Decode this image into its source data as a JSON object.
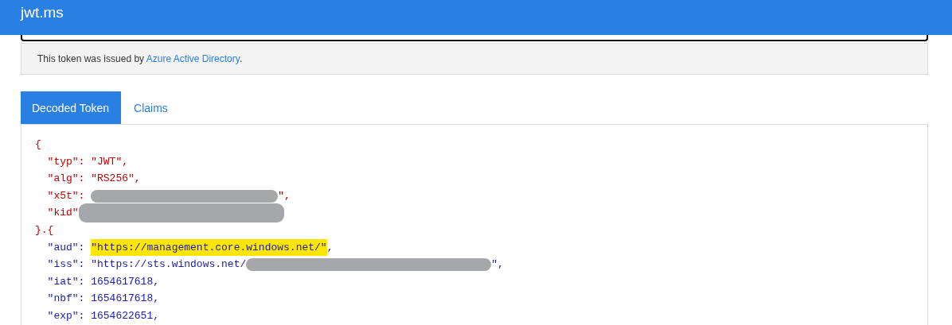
{
  "header": {
    "title": "jwt.ms"
  },
  "issuer_notice": {
    "text": "This token was issued by ",
    "link": "Azure Active Directory",
    "end": "."
  },
  "tabs": [
    {
      "label": "Decoded Token",
      "selected": true
    },
    {
      "label": "Claims",
      "selected": false
    }
  ],
  "decoded_token": {
    "lines": [
      {
        "color": "#c00000",
        "parts": [
          {
            "kind": "text",
            "text": "{"
          }
        ]
      },
      {
        "color": "#c00000",
        "parts": [
          {
            "kind": "text",
            "text": "  \"typ\": \"JWT\","
          }
        ]
      },
      {
        "color": "#c00000",
        "parts": [
          {
            "kind": "text",
            "text": "  \"alg\": \"RS256\","
          }
        ]
      },
      {
        "color": "#c00000",
        "parts": [
          {
            "kind": "text",
            "text": "  \"x5t\": "
          },
          {
            "kind": "redacted"
          },
          {
            "kind": "text",
            "text": "\","
          }
        ]
      },
      {
        "color": "#c00000",
        "parts": [
          {
            "kind": "text",
            "text": "  \"kid\""
          },
          {
            "kind": "redacted"
          }
        ]
      },
      {
        "color": "#c00000",
        "parts": [
          {
            "kind": "text",
            "text": "}.{"
          }
        ]
      },
      {
        "color": "#1a1aa6",
        "parts": [
          {
            "kind": "text",
            "text": "  \"aud\": "
          },
          {
            "kind": "highlight",
            "text": "\"https://management.core.windows.net/\""
          },
          {
            "kind": "text",
            "text": ","
          }
        ]
      },
      {
        "color": "#1a1aa6",
        "parts": [
          {
            "kind": "text",
            "text": "  \"iss\": \"https://sts.windows.net/"
          },
          {
            "kind": "redacted"
          },
          {
            "kind": "text",
            "text": "\","
          }
        ]
      },
      {
        "color": "#1a1aa6",
        "parts": [
          {
            "kind": "text",
            "text": "  \"iat\": 1654617618,"
          }
        ]
      },
      {
        "color": "#1a1aa6",
        "parts": [
          {
            "kind": "text",
            "text": "  \"nbf\": 1654617618,"
          }
        ]
      },
      {
        "color": "#1a1aa6",
        "parts": [
          {
            "kind": "text",
            "text": "  \"exp\": 1654622651,"
          }
        ]
      }
    ]
  }
}
